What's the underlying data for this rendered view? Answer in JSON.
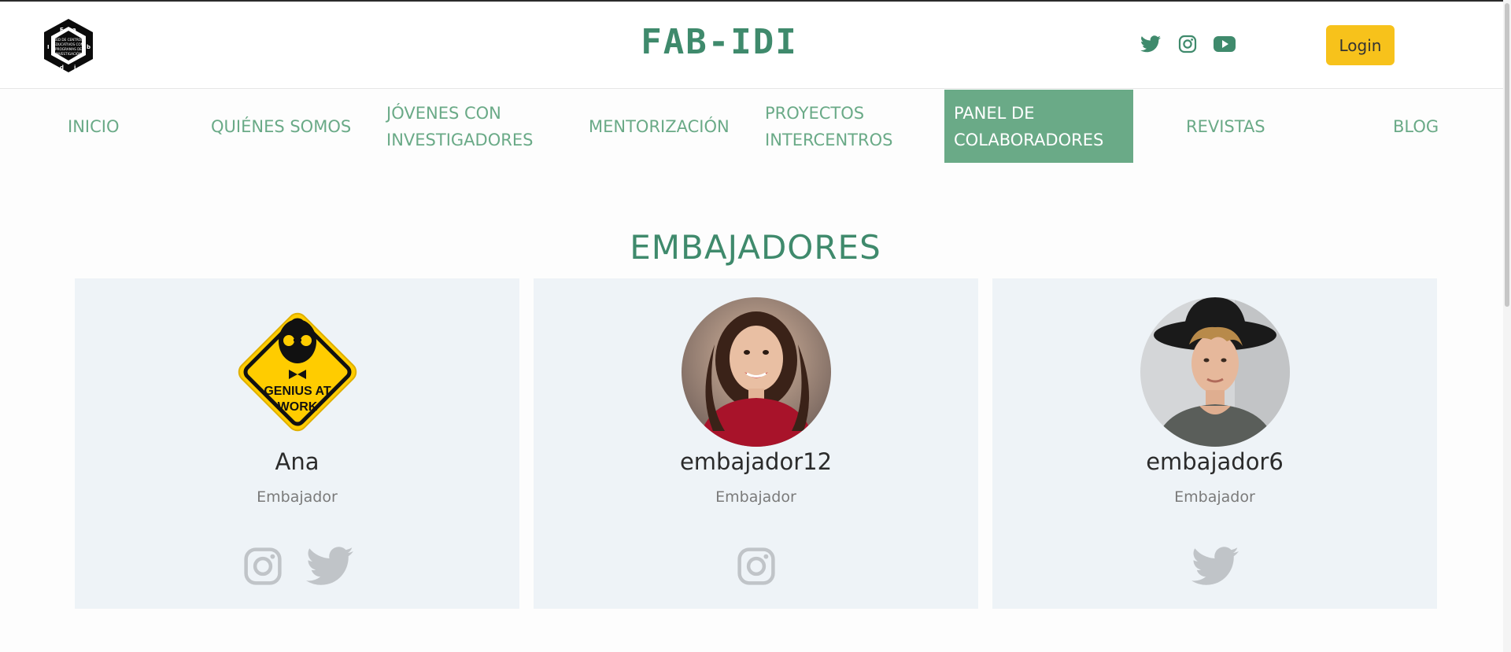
{
  "header": {
    "site_title": "FAB-IDI",
    "login_label": "Login",
    "social_icons": [
      "twitter-icon",
      "instagram-icon",
      "youtube-icon"
    ],
    "logo_text": {
      "corner_letters": [
        "F",
        "a",
        "b",
        "I",
        "d",
        "i"
      ],
      "center_lines": [
        "RED DE CENTROS",
        "EDUCATIVOS CON",
        "PROGRAMAS DE",
        "INVESTIGACIÓN"
      ]
    }
  },
  "nav": {
    "items": [
      {
        "line1": "INICIO",
        "line2": ""
      },
      {
        "line1": "QUIÉNES SOMOS",
        "line2": ""
      },
      {
        "line1": "JÓVENES CON",
        "line2": "INVESTIGADORES"
      },
      {
        "line1": "MENTORIZACIÓN",
        "line2": ""
      },
      {
        "line1": "PROYECTOS",
        "line2": "INTERCENTROS"
      },
      {
        "line1": "PANEL DE",
        "line2": "COLABORADORES"
      },
      {
        "line1": "REVISTAS",
        "line2": ""
      },
      {
        "line1": "BLOG",
        "line2": ""
      }
    ],
    "active_index": 5
  },
  "section": {
    "title": "EMBAJADORES"
  },
  "ambassadors": [
    {
      "name": "Ana",
      "role": "Embajador",
      "avatar": "genius-at-work-sign",
      "avatar_text": [
        "GENIUS AT",
        "WORK"
      ],
      "socials": [
        "instagram-icon",
        "twitter-icon"
      ]
    },
    {
      "name": "embajador12",
      "role": "Embajador",
      "avatar": "woman-photo",
      "socials": [
        "instagram-icon"
      ]
    },
    {
      "name": "embajador6",
      "role": "Embajador",
      "avatar": "man-with-hat-photo",
      "socials": [
        "twitter-icon"
      ]
    }
  ],
  "colors": {
    "primary_green": "#3f8a6c",
    "nav_green": "#6aaa87",
    "login_yellow": "#f7c21b",
    "card_bg": "#eef3f7",
    "icon_gray": "#c0c4c8"
  }
}
